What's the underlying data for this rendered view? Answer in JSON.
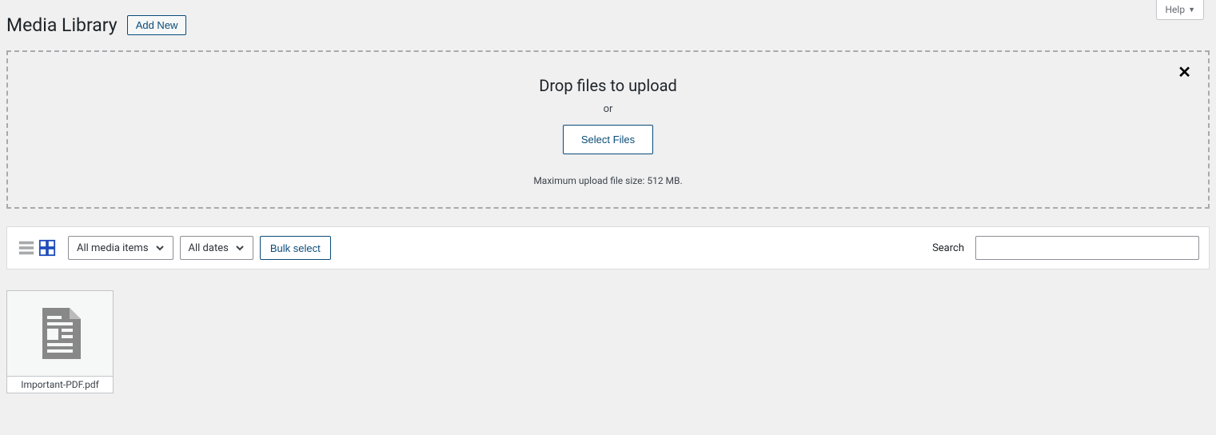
{
  "help": {
    "label": "Help"
  },
  "header": {
    "title": "Media Library",
    "add_new": "Add New"
  },
  "dropzone": {
    "title": "Drop files to upload",
    "or": "or",
    "select_files": "Select Files",
    "hint": "Maximum upload file size: 512 MB."
  },
  "toolbar": {
    "filter_type": "All media items",
    "filter_date": "All dates",
    "bulk_select": "Bulk select",
    "search_label": "Search"
  },
  "media": {
    "items": [
      {
        "filename": "Important-PDF.pdf"
      }
    ]
  }
}
